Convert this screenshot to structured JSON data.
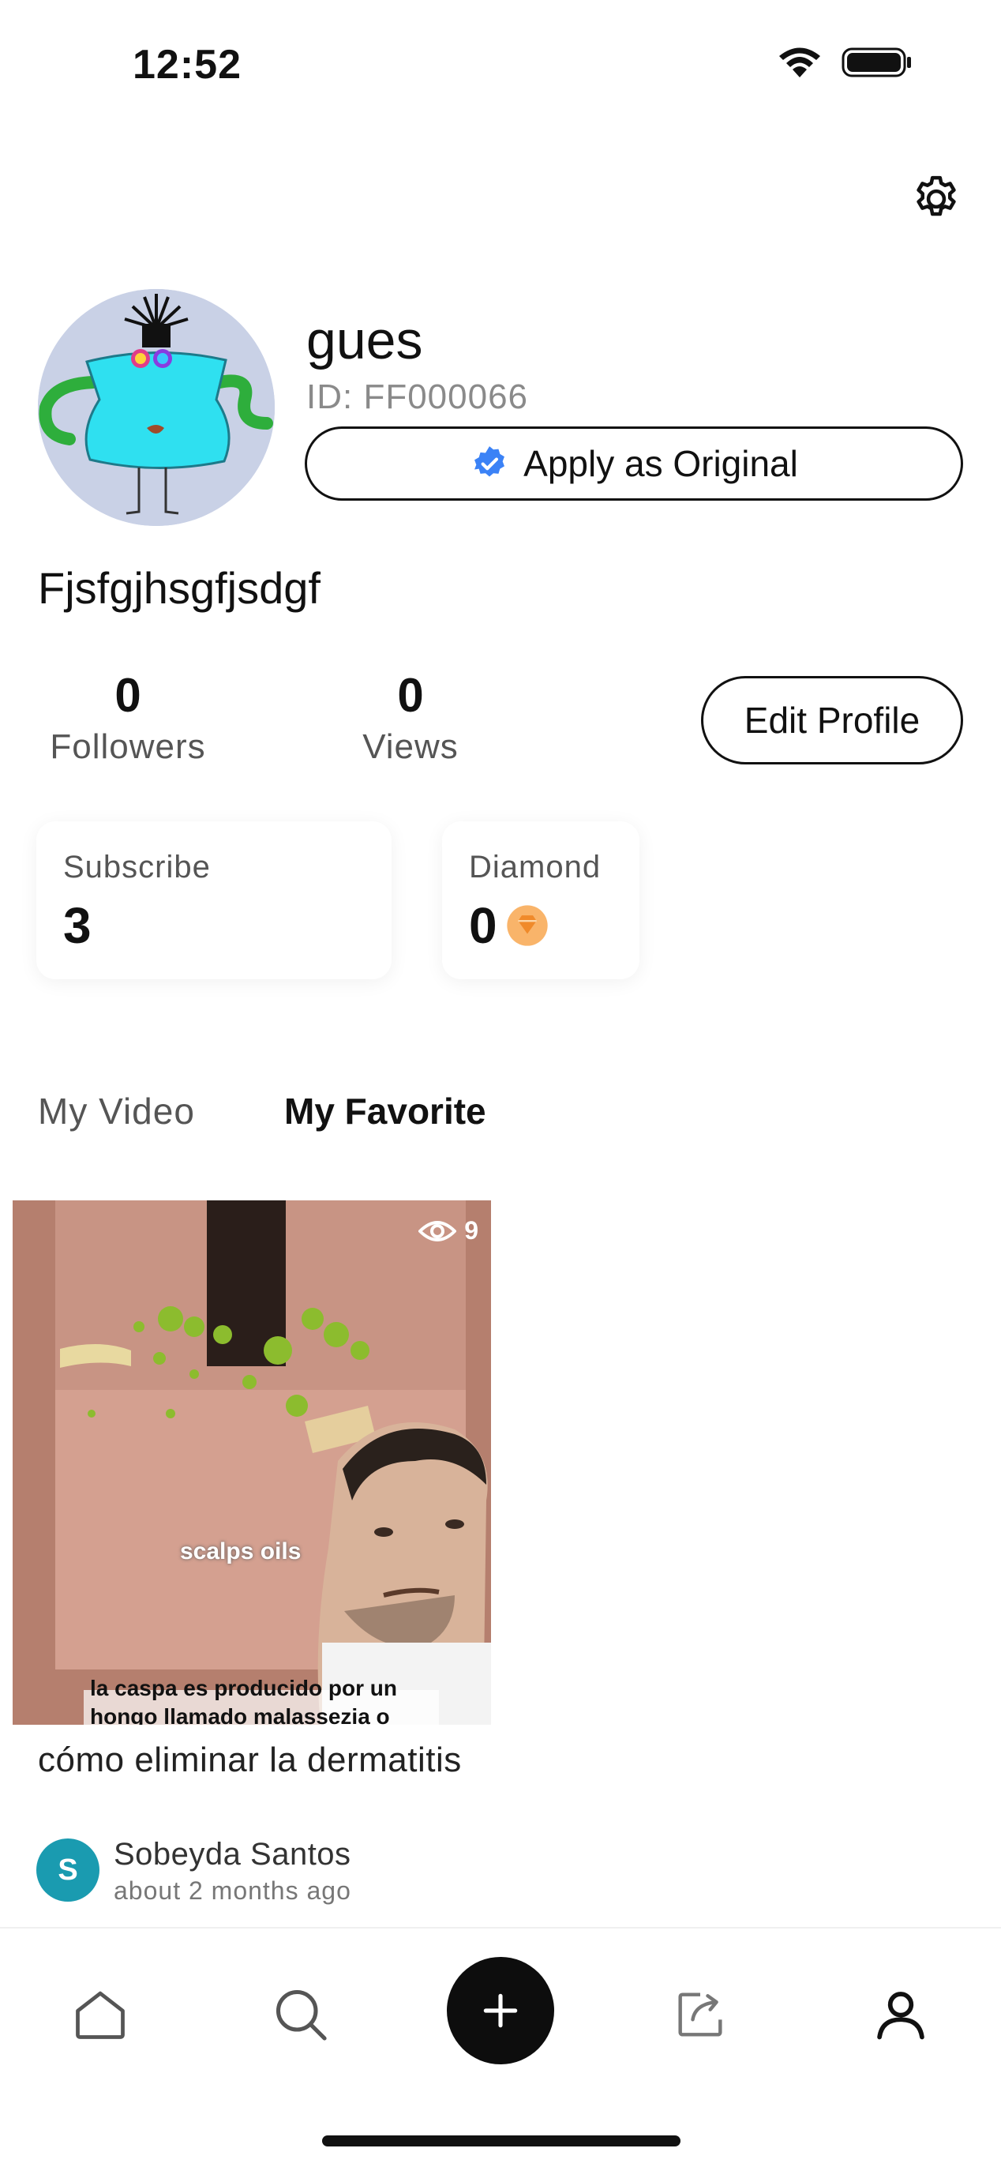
{
  "status_bar": {
    "time": "12:52"
  },
  "profile": {
    "username": "gues",
    "user_id": "ID: FF000066",
    "apply_label": "Apply as Original",
    "display_name": "Fjsfgjhsgfjsdgf",
    "edit_label": "Edit Profile"
  },
  "stats": {
    "followers": {
      "value": "0",
      "label": "Followers"
    },
    "views": {
      "value": "0",
      "label": "Views"
    }
  },
  "cards": {
    "subscribe": {
      "label": "Subscribe",
      "value": "3"
    },
    "diamond": {
      "label": "Diamond",
      "value": "0"
    }
  },
  "tabs": [
    {
      "label": "My Video",
      "active": false
    },
    {
      "label": "My Favorite",
      "active": true
    }
  ],
  "favorites": [
    {
      "views": "9",
      "overlay_text": "scalps oils",
      "caption_lines": [
        "la caspa es producido por un",
        "hongo llamado malassezia o"
      ],
      "title": "cómo eliminar la dermatitis",
      "author": {
        "initial": "S",
        "name": "Sobeyda Santos",
        "time": "about 2 months ago",
        "color": "#1a9bb0"
      }
    }
  ],
  "colors": {
    "accent": "#111111",
    "verified": "#3b82f6",
    "diamond": "#f5a04a"
  },
  "nav": [
    {
      "name": "home-icon"
    },
    {
      "name": "search-icon"
    },
    {
      "name": "add-icon"
    },
    {
      "name": "share-icon"
    },
    {
      "name": "profile-icon"
    }
  ]
}
